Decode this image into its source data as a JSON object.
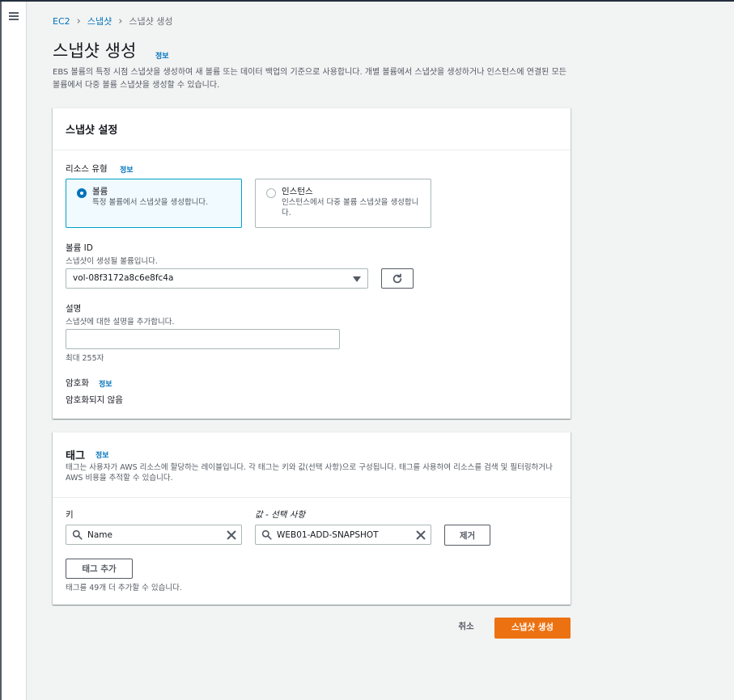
{
  "breadcrumb": {
    "ec2": "EC2",
    "snapshots": "스냅샷",
    "current": "스냅샷 생성",
    "separator": "›"
  },
  "page": {
    "title": "스냅샷 생성",
    "info": "정보",
    "description": "EBS 볼륨의 특정 시점 스냅샷을 생성하여 새 볼륨 또는 데이터 백업의 기준으로 사용합니다. 개별 볼륨에서 스냅샷을 생성하거나 인스턴스에 연결된 모든 볼륨에서 다중 볼륨 스냅샷을 생성할 수 있습니다."
  },
  "settings": {
    "title": "스냅샷 설정",
    "resource_type_label": "리소스 유형",
    "resource_type_info": "정보",
    "resource_options": [
      {
        "title": "볼륨",
        "desc": "특정 볼륨에서 스냅샷을 생성합니다.",
        "selected": true
      },
      {
        "title": "인스턴스",
        "desc": "인스턴스에서 다중 볼륨 스냅샷을 생성합니다.",
        "selected": false
      }
    ],
    "volume_id_label": "볼륨 ID",
    "volume_id_desc": "스냅샷이 생성될 볼륨입니다.",
    "volume_id_value": "vol-08f3172a8c6e8fc4a",
    "description_label": "설명",
    "description_desc": "스냅샷에 대한 설명을 추가합니다.",
    "description_value": "",
    "description_hint": "최대 255자",
    "encryption_label": "암호화",
    "encryption_info": "정보",
    "encryption_value": "암호화되지 않음"
  },
  "tags": {
    "title": "태그",
    "info": "정보",
    "description": "태그는 사용자가 AWS 리소스에 할당하는 레이블입니다. 각 태그는 키와 값(선택 사항)으로 구성됩니다. 태그를 사용하여 리소스를 검색 및 필터링하거나 AWS 비용을 추적할 수 있습니다.",
    "key_label": "키",
    "value_label": "값 - 선택 사항",
    "key_value": "Name",
    "value_value": "WEB01-ADD-SNAPSHOT",
    "remove_label": "제거",
    "add_label": "태그 추가",
    "remaining_hint": "태그를 49개 더 추가할 수 있습니다."
  },
  "footer": {
    "cancel": "취소",
    "create": "스냅샷 생성"
  },
  "colors": {
    "primary": "#ec7211",
    "link": "#0073bb",
    "selected_border": "#00a1c9",
    "background": "#f2f3f3"
  },
  "icons": {
    "menu": "hamburger-menu-icon",
    "refresh": "refresh-icon",
    "search": "search-icon",
    "clear": "close-icon",
    "dropdown": "caret-down-icon"
  }
}
